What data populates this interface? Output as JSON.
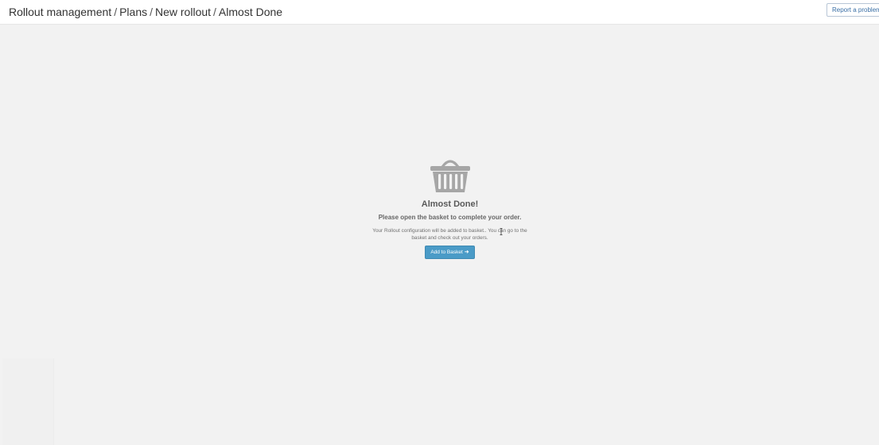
{
  "header": {
    "breadcrumb": [
      {
        "label": "Rollout management"
      },
      {
        "label": "Plans"
      },
      {
        "label": "New rollout"
      },
      {
        "label": "Almost Done"
      }
    ],
    "separator": "/",
    "report_label": "Report a problem"
  },
  "main": {
    "icon": "basket-icon",
    "title": "Almost Done!",
    "subtitle": "Please open the basket to complete your order.",
    "description": "Your Rollout configuration will be added to basket.. You can go to the basket and check out your orders.",
    "button_label": "Add to Basket",
    "button_icon": "arrow-right-icon"
  },
  "colors": {
    "background": "#f2f2f2",
    "header_bg": "#ffffff",
    "accent": "#4a9bc7",
    "basket": "#a6a6a6"
  }
}
